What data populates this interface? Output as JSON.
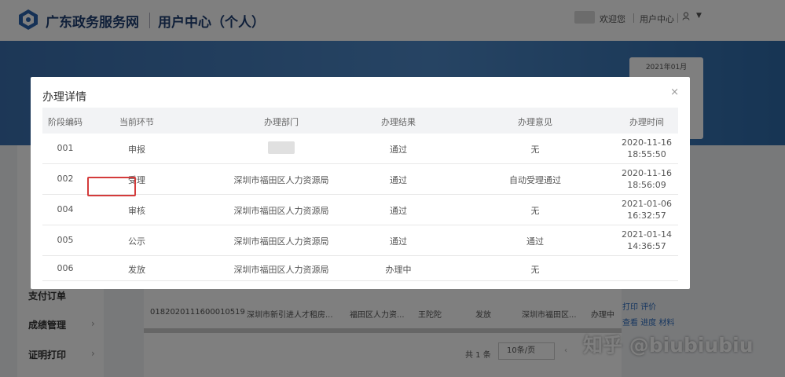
{
  "header": {
    "site_name": "广东政务服务网",
    "site_sub": "用户中心（个人）",
    "welcome": "欢迎您",
    "user_center": "用户中心",
    "user_icon": "user-icon",
    "caret_icon": "caret-down-icon"
  },
  "calendar": {
    "month": "2021年01月"
  },
  "sidebar": {
    "items": [
      {
        "label": "支付订单"
      },
      {
        "label": "成绩管理"
      },
      {
        "label": "证明打印"
      }
    ]
  },
  "background_table": {
    "row": [
      "0182020111600010519",
      "深圳市新引进人才租房...",
      "福田区人力资...",
      "王陀陀",
      "发放",
      "深圳市福田区...",
      "办理中"
    ],
    "actions": [
      "打印",
      "评价",
      "查看",
      "进度",
      "材料"
    ]
  },
  "pager": {
    "total": "共 1 条",
    "page_size": "10条/页"
  },
  "watermark": "知乎 @biubiubiu",
  "modal": {
    "title": "办理详情",
    "close": "×",
    "columns": [
      "阶段编码",
      "当前环节",
      "办理部门",
      "办理结果",
      "办理意见",
      "办理时间"
    ],
    "rows": [
      {
        "code": "001",
        "stage": "申报",
        "dept": "",
        "result": "通过",
        "opinion": "无",
        "date": "2020-11-16",
        "time": "18:55:50"
      },
      {
        "code": "002",
        "stage": "受理",
        "dept": "深圳市福田区人力资源局",
        "result": "通过",
        "opinion": "自动受理通过",
        "date": "2020-11-16",
        "time": "18:56:09"
      },
      {
        "code": "004",
        "stage": "审核",
        "dept": "深圳市福田区人力资源局",
        "result": "通过",
        "opinion": "无",
        "date": "2021-01-06",
        "time": "16:32:57"
      },
      {
        "code": "005",
        "stage": "公示",
        "dept": "深圳市福田区人力资源局",
        "result": "通过",
        "opinion": "通过",
        "date": "2021-01-14",
        "time": "14:36:57"
      },
      {
        "code": "006",
        "stage": "发放",
        "dept": "深圳市福田区人力资源局",
        "result": "办理中",
        "opinion": "无",
        "date": "",
        "time": ""
      }
    ]
  },
  "colors": {
    "brand": "#1f3f73",
    "banner": "#4d88c7",
    "highlight": "#d43b3b"
  }
}
